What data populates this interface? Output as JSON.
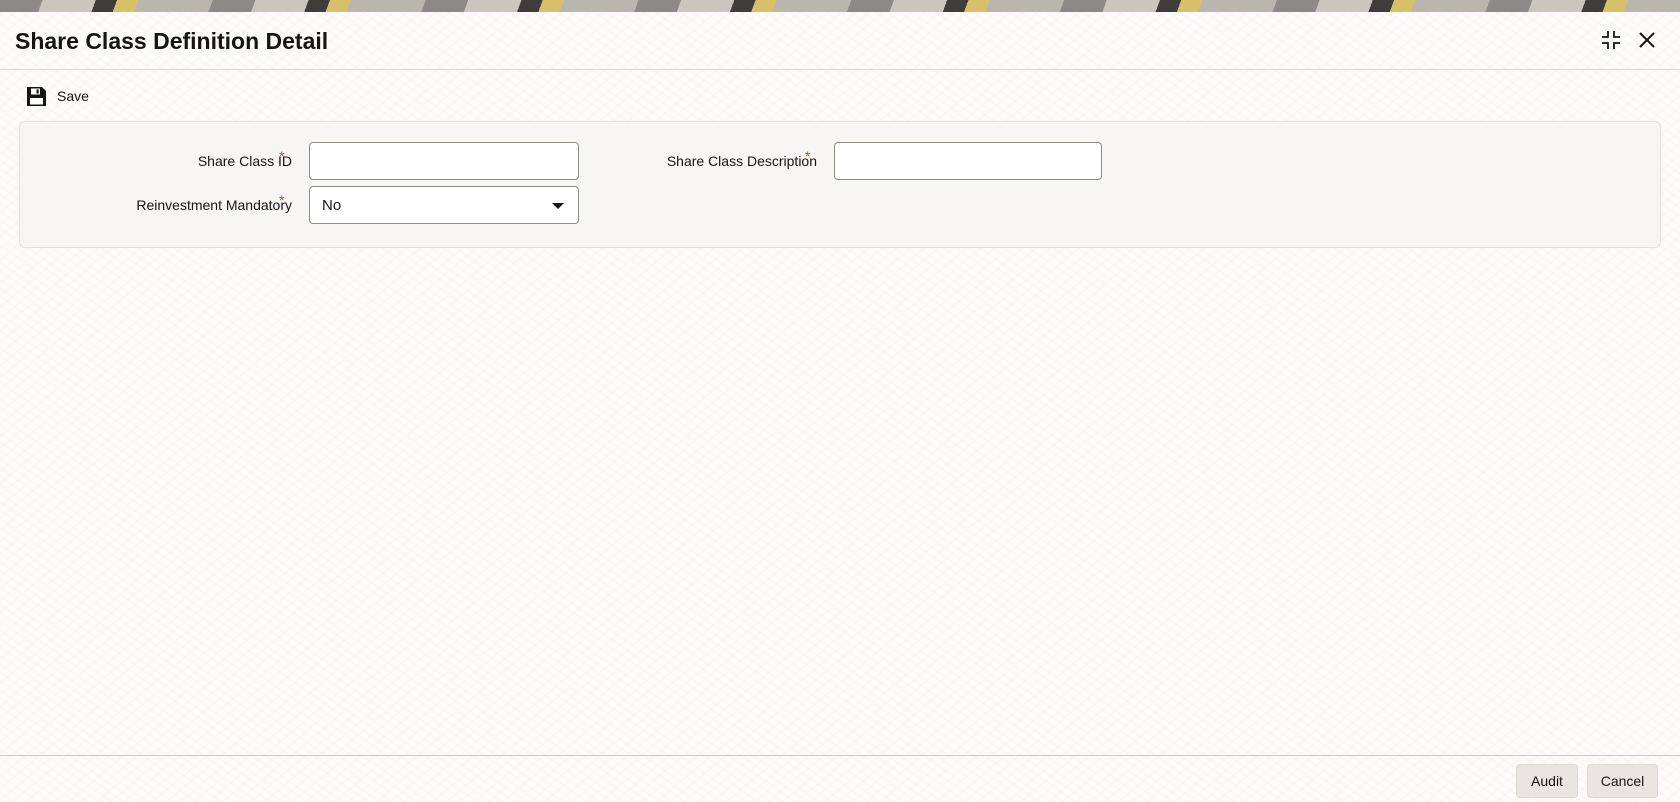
{
  "header": {
    "title": "Share Class Definition Detail",
    "restore_icon": "collapse-icon",
    "close_icon": "close-icon"
  },
  "toolbar": {
    "save_label": "Save",
    "save_icon": "floppy-disk-icon"
  },
  "form": {
    "share_class_id": {
      "label": "Share Class ID",
      "required_mark": "*",
      "value": ""
    },
    "share_class_description": {
      "label": "Share Class Description",
      "required_mark": "*",
      "value": ""
    },
    "reinvestment_mandatory": {
      "label": "Reinvestment Mandatory",
      "required_mark": "*",
      "value": "No"
    }
  },
  "footer": {
    "audit_label": "Audit",
    "cancel_label": "Cancel"
  },
  "colors": {
    "required": "#c74634",
    "panel_bg": "#f7f6f4"
  }
}
